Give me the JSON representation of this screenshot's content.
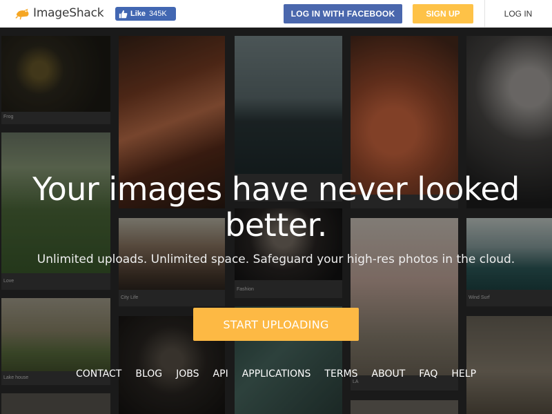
{
  "header": {
    "logo_text": "ImageShack",
    "logo_icon": "frog-icon",
    "fb_like": {
      "label": "Like",
      "count": "345K",
      "icon": "thumbs-up-icon"
    },
    "login_facebook_label": "LOG IN WITH FACEBOOK",
    "signup_label": "SIGN UP",
    "login_label": "LOG IN"
  },
  "mosaic": {
    "captions": [
      "Frog",
      "Love",
      "Lake house",
      "City Life",
      "Fashion",
      "Wind Surf",
      "LA"
    ]
  },
  "hero": {
    "headline": "Your images have never looked better.",
    "subline": "Unlimited uploads. Unlimited space. Safeguard your high-res photos in the cloud.",
    "cta_label": "START UPLOADING"
  },
  "footer": {
    "links": [
      "CONTACT",
      "BLOG",
      "JOBS",
      "API",
      "APPLICATIONS",
      "TERMS",
      "ABOUT",
      "FAQ",
      "HELP"
    ]
  },
  "colors": {
    "facebook_blue": "#4a67ad",
    "signup_yellow": "#fec247",
    "cta_orange": "#fdb944",
    "fb_like_blue": "#4267b2"
  }
}
